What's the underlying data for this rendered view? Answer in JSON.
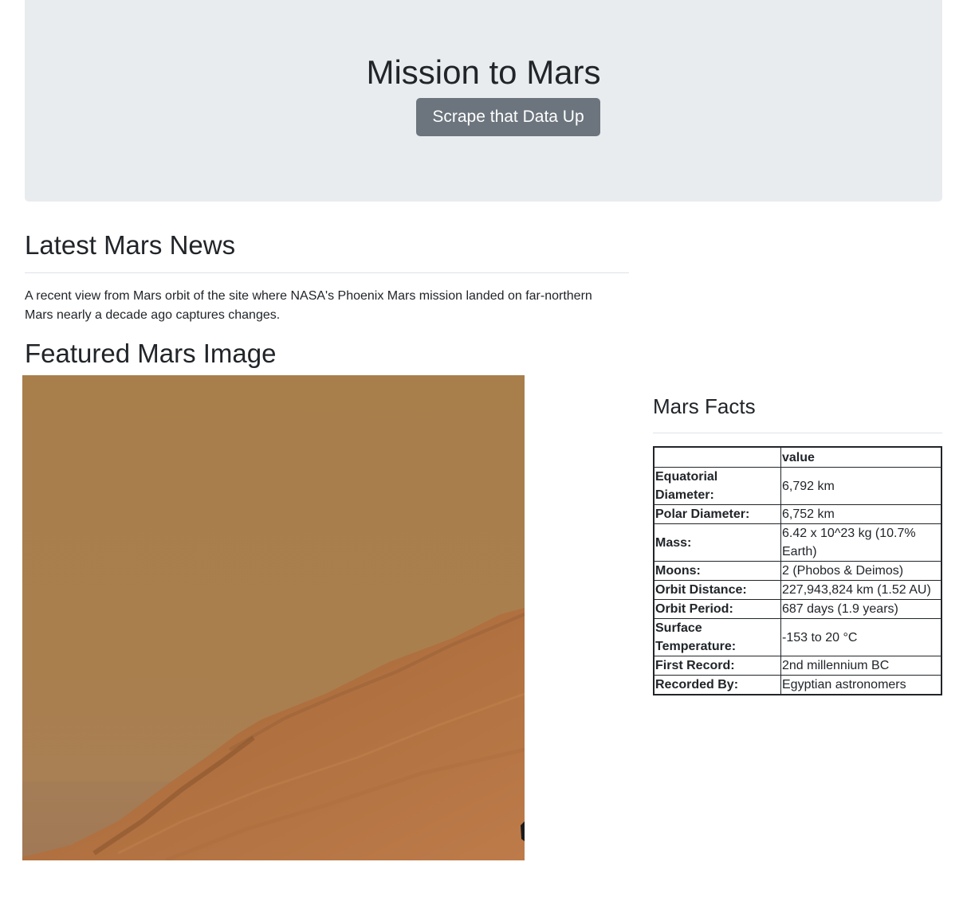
{
  "jumbotron": {
    "title": "Mission to Mars",
    "button_label": "Scrape that Data Up"
  },
  "news": {
    "heading": "Latest Mars News",
    "paragraph": "A recent view from Mars orbit of the site where NASA's Phoenix Mars mission landed on far-northern Mars nearly a decade ago captures changes."
  },
  "featured_image": {
    "heading": "Featured Mars Image"
  },
  "facts": {
    "heading": "Mars Facts",
    "header": [
      "",
      "value"
    ],
    "rows": [
      {
        "label": "Equatorial Diameter:",
        "value": "6,792 km"
      },
      {
        "label": "Polar Diameter:",
        "value": "6,752 km"
      },
      {
        "label": "Mass:",
        "value": "6.42 x 10^23 kg (10.7% Earth)"
      },
      {
        "label": "Moons:",
        "value": "2 (Phobos & Deimos)"
      },
      {
        "label": "Orbit Distance:",
        "value": "227,943,824 km (1.52 AU)"
      },
      {
        "label": "Orbit Period:",
        "value": "687 days (1.9 years)"
      },
      {
        "label": "Surface Temperature:",
        "value": "-153 to 20 °C"
      },
      {
        "label": "First Record:",
        "value": "2nd millennium BC"
      },
      {
        "label": "Recorded By:",
        "value": "Egyptian astronomers"
      }
    ]
  },
  "colors": {
    "jumbotron_bg": "#e9ecef",
    "button_bg": "#6c757d",
    "sky": "#a97f4c",
    "ground": "#b56f3f"
  }
}
